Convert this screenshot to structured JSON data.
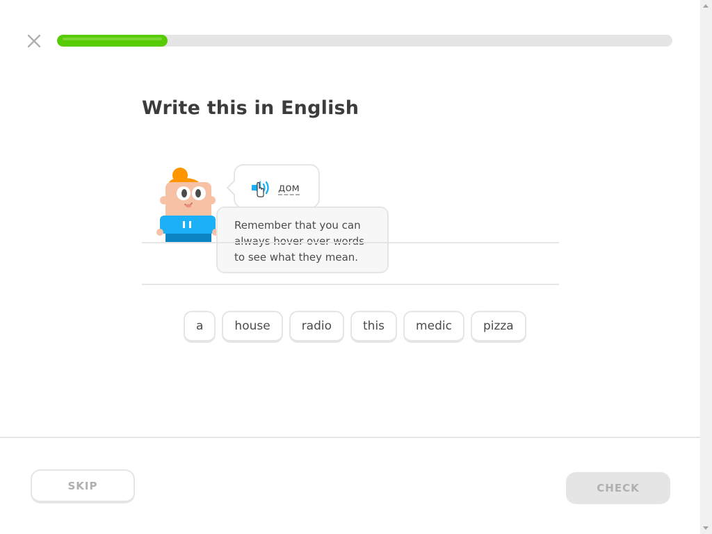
{
  "header": {
    "close_icon": "close-icon",
    "progress_fraction": 0.18,
    "progress_color": "#58cc02"
  },
  "challenge": {
    "title": "Write this in English",
    "prompt_word": "дом",
    "speaker_icon": "speaker-icon",
    "hint_tooltip": {
      "lines": [
        "Remember that you can",
        "always hover over words",
        "to see what they mean."
      ]
    }
  },
  "word_bank": {
    "words": [
      "a",
      "house",
      "radio",
      "this",
      "medic",
      "pizza"
    ]
  },
  "footer": {
    "skip_label": "SKIP",
    "check_label": "CHECK"
  },
  "colors": {
    "accent_green": "#58cc02",
    "speaker_blue": "#1cb0f6",
    "border_gray": "#e5e5e5",
    "text_dark": "#3c3c3c",
    "disabled_text": "#afafaf"
  }
}
